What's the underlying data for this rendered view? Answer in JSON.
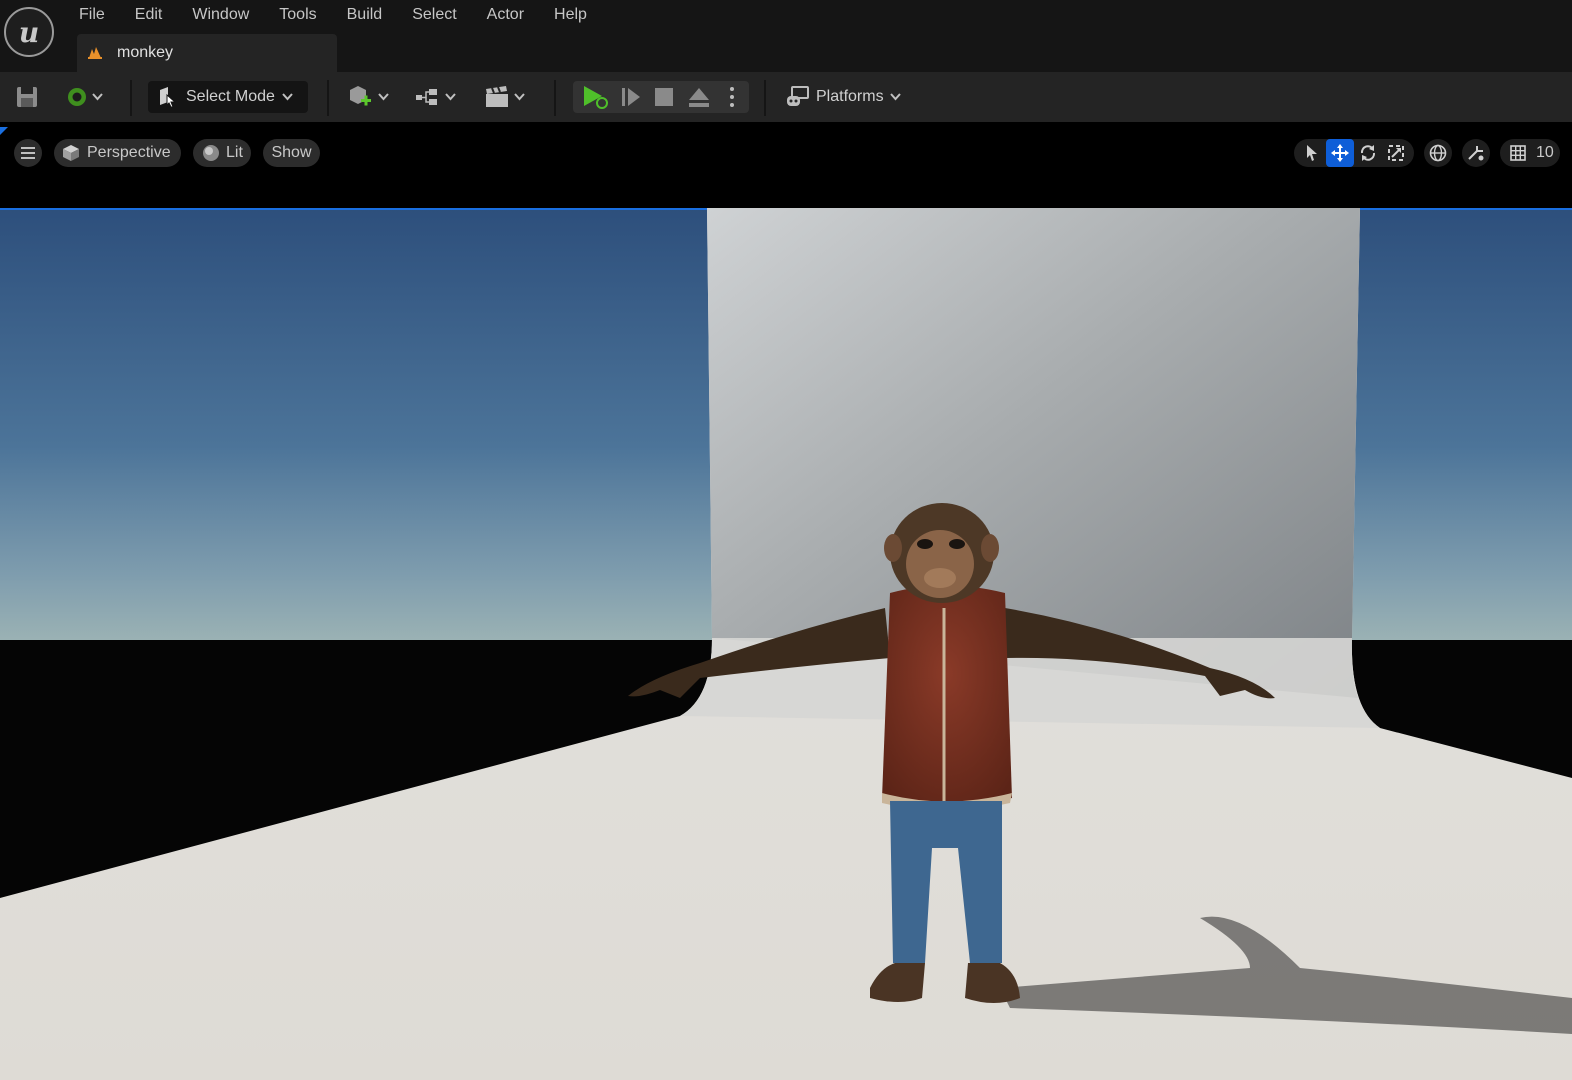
{
  "menu": {
    "items": [
      {
        "label": "File"
      },
      {
        "label": "Edit"
      },
      {
        "label": "Window"
      },
      {
        "label": "Tools"
      },
      {
        "label": "Build"
      },
      {
        "label": "Select"
      },
      {
        "label": "Actor"
      },
      {
        "label": "Help"
      }
    ]
  },
  "document_tab": {
    "label": "monkey"
  },
  "toolbar": {
    "select_mode_label": "Select Mode",
    "platforms_label": "Platforms"
  },
  "viewport": {
    "perspective_label": "Perspective",
    "lit_label": "Lit",
    "show_label": "Show",
    "grid_snap_value": "10"
  },
  "colors": {
    "accent": "#0e5ed8",
    "play_green": "#4fbf2a",
    "topbar": "#151515",
    "toolbar": "#242424"
  }
}
